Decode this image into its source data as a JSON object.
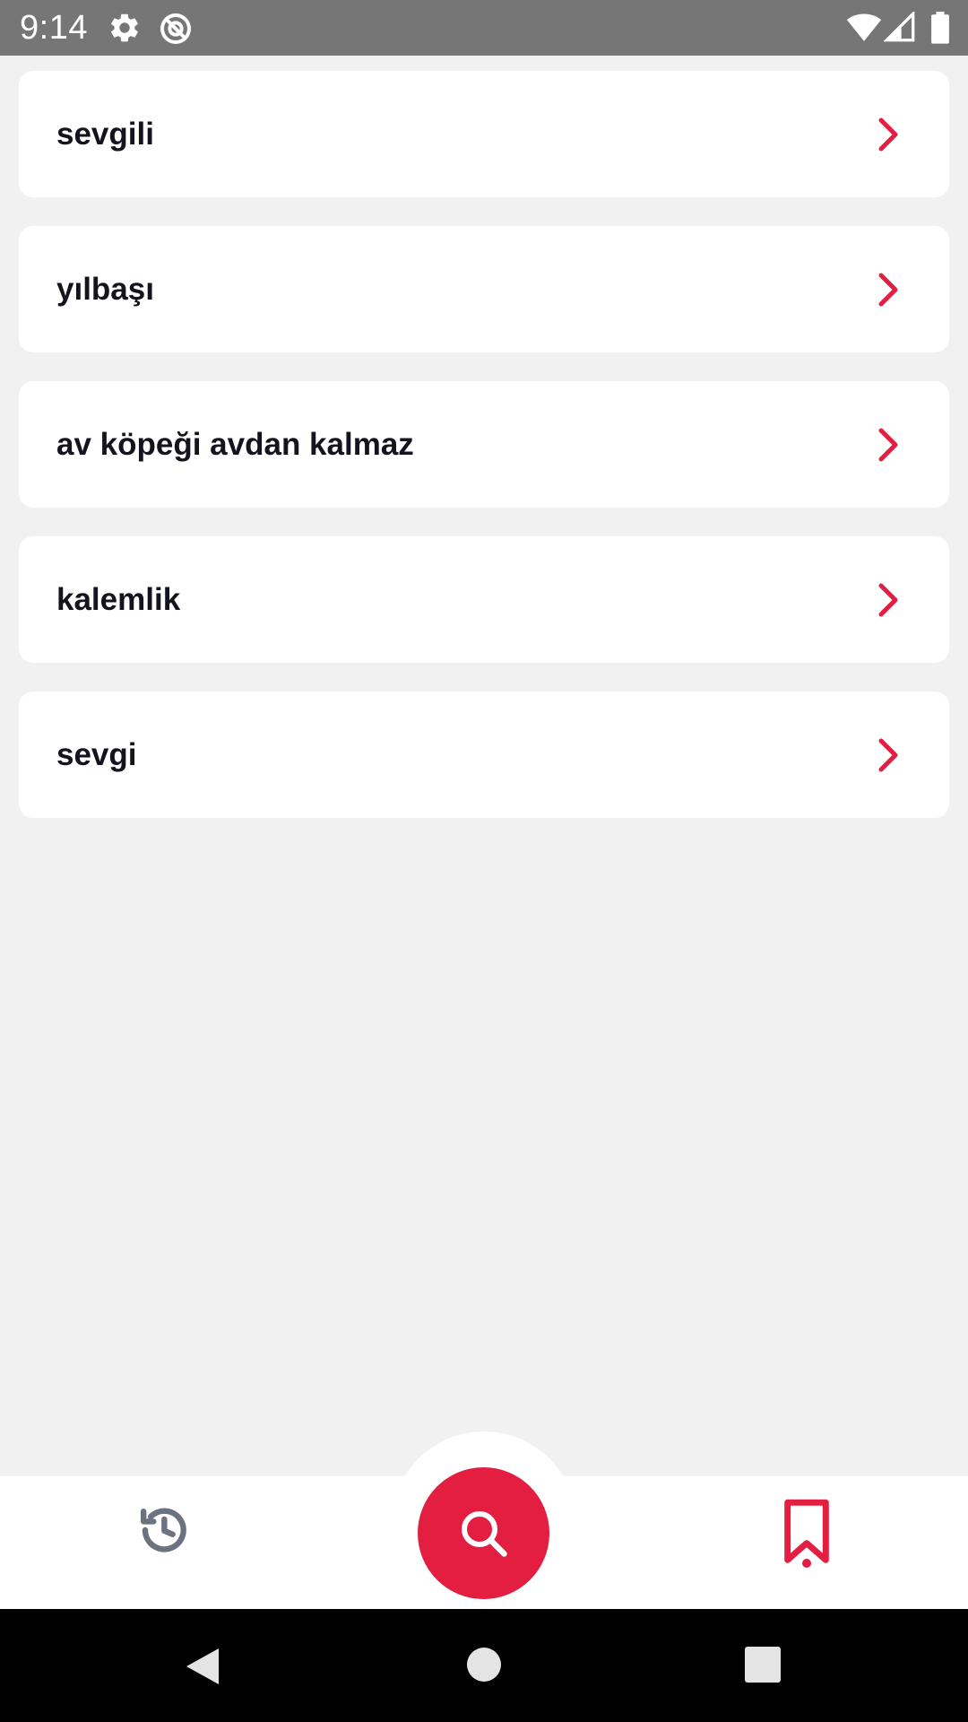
{
  "status_bar": {
    "time": "9:14",
    "icons": [
      "settings-icon",
      "data-saver-icon",
      "wifi-icon",
      "signal-icon",
      "battery-icon"
    ]
  },
  "results": [
    {
      "label": "sevgili"
    },
    {
      "label": "yılbaşı"
    },
    {
      "label": "av köpeği avdan kalmaz"
    },
    {
      "label": "kalemlik"
    },
    {
      "label": "sevgi"
    }
  ],
  "bottom_nav": {
    "items": [
      {
        "icon": "history-icon"
      },
      {
        "icon": "search-icon"
      },
      {
        "icon": "bookmark-icon"
      }
    ],
    "selected": "bookmark-icon"
  },
  "system_nav": {
    "items": [
      "back-icon",
      "home-icon",
      "recents-icon"
    ]
  },
  "colors": {
    "accent": "#e31e41",
    "background": "#f1f1f1",
    "card": "#ffffff",
    "text": "#14141e",
    "status_bar": "#767676",
    "icon_gray": "#6b7280"
  }
}
